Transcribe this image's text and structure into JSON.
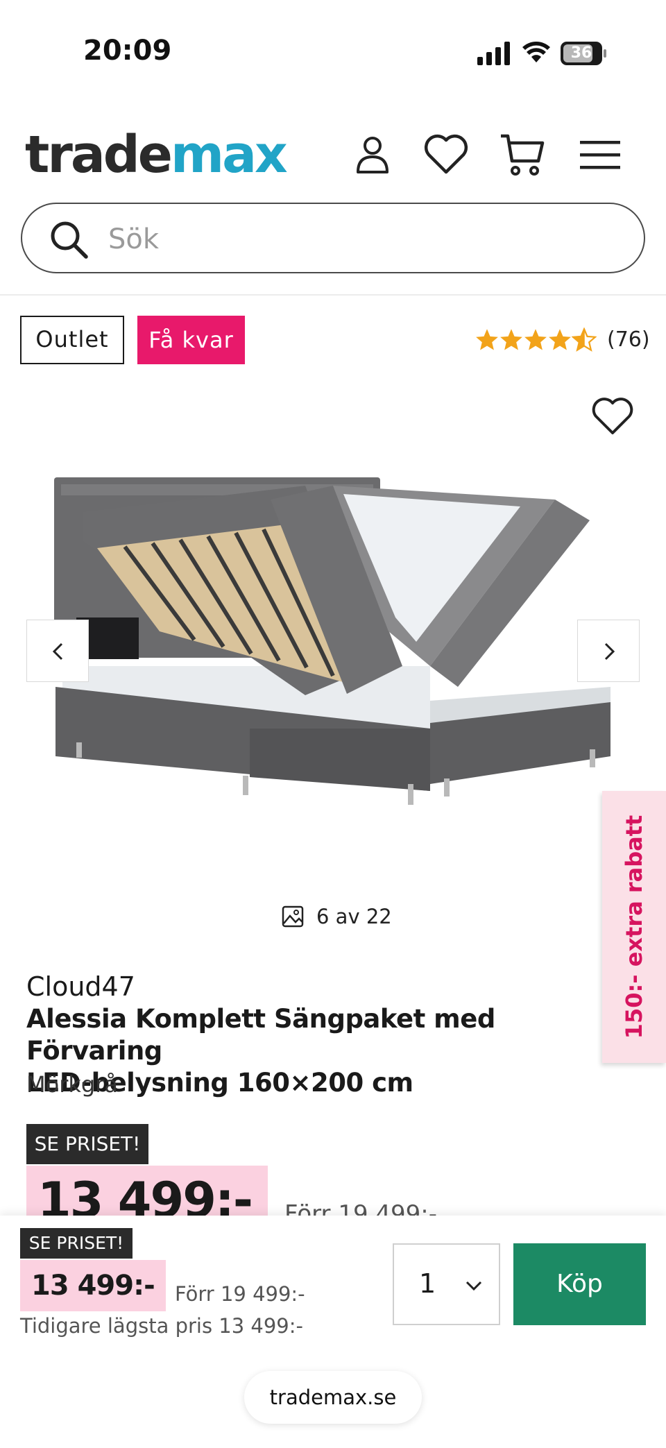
{
  "status_bar": {
    "time": "20:09",
    "battery": "36"
  },
  "header": {
    "logo_part1": "trade",
    "logo_part2": "max",
    "icons": [
      "user-icon",
      "heart-icon",
      "cart-icon",
      "menu-icon"
    ]
  },
  "search": {
    "placeholder": "Sök"
  },
  "badges": {
    "outlet": "Outlet",
    "few_left": "Få kvar"
  },
  "rating": {
    "stars": 4.5,
    "max": 5,
    "count": "(76)"
  },
  "gallery": {
    "counter": "6 av 22"
  },
  "promo_tab": {
    "text": "150:- extra rabatt"
  },
  "product": {
    "brand": "Cloud47",
    "title_line1": "Alessia Komplett Sängpaket med Förvaring",
    "title_line2": "LED-belysning 160×200 cm",
    "color": "Mörkgrå",
    "price_badge": "SE PRISET!",
    "price": "13 499:-",
    "previous_price": "Förr 19 499:-"
  },
  "sticky_bar": {
    "price_badge": "SE PRISET!",
    "price": "13 499:-",
    "previous_price": "Förr 19 499:-",
    "lowest_price": "Tidigare lägsta pris 13 499:-",
    "quantity": "1",
    "buy_label": "Köp"
  },
  "browser": {
    "url": "trademax.se"
  },
  "colors": {
    "accent_pink": "#e8196b",
    "buy_green": "#1c8a64",
    "logo_blue": "#21a4c7",
    "price_bg": "#fbd1e0"
  }
}
